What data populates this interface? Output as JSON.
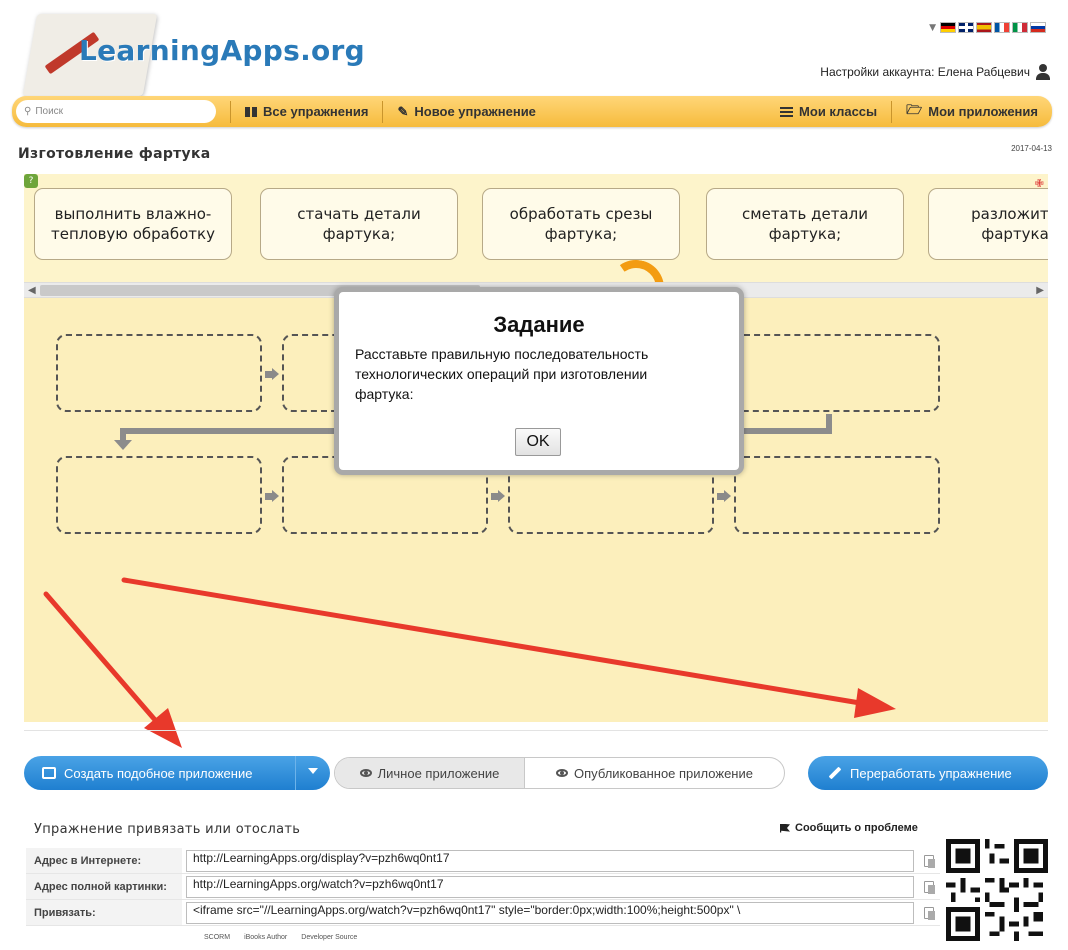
{
  "header": {
    "logo_text": "LearningApps.org",
    "account_label": "Настройки аккаунта: Елена Рабцевич",
    "languages": [
      {
        "name": "Deutsch",
        "colors": [
          "#000000",
          "#dd0000",
          "#ffce00"
        ]
      },
      {
        "name": "English",
        "colors": [
          "#012169",
          "#ffffff",
          "#c8102e"
        ]
      },
      {
        "name": "Español",
        "colors": [
          "#aa151b",
          "#f1bf00",
          "#aa151b"
        ]
      },
      {
        "name": "Français",
        "colors": [
          "#0055a4",
          "#ffffff",
          "#ef4135"
        ]
      },
      {
        "name": "Italiano",
        "colors": [
          "#009246",
          "#ffffff",
          "#ce2b37"
        ]
      },
      {
        "name": "Русский",
        "colors": [
          "#ffffff",
          "#0039a6",
          "#d52b1e"
        ]
      }
    ]
  },
  "nav": {
    "search_placeholder": "Поиск",
    "all_exercises": "Все упражнения",
    "new_exercise": "Новое упражнение",
    "my_classes": "Мои классы",
    "my_apps": "Мои приложения"
  },
  "page": {
    "title": "Изготовление фартука",
    "date": "2017-04-13"
  },
  "app": {
    "cards": [
      "выполнить влажно-\nтепловую обработку",
      "стачать детали\nфартука;",
      "обработать срезы\nфартука;",
      "сметать детали\nфартука;",
      "разложить вы\nфартука на"
    ]
  },
  "modal": {
    "title": "Задание",
    "text": "Расставьте правильную последовательность технологических операций при изготовлении фартука:",
    "ok_label": "OK"
  },
  "actions": {
    "create_similar": "Создать подобное приложение",
    "private_app": "Личное приложение",
    "published_app": "Опубликованное приложение",
    "rework": "Переработать упражнение"
  },
  "share": {
    "title": "Упражнение привязать или отослать",
    "report_problem": "Сообщить о проблеме",
    "rows": [
      {
        "label": "Адрес в Интернете:",
        "value": "http://LearningApps.org/display?v=pzh6wq0nt17"
      },
      {
        "label": "Адрес полной картинки:",
        "value": "http://LearningApps.org/watch?v=pzh6wq0nt17"
      },
      {
        "label": "Привязать:",
        "value": "<iframe src=\"//LearningApps.org/watch?v=pzh6wq0nt17\" style=\"border:0px;width:100%;height:500px\" \\"
      }
    ],
    "exports": [
      "SCORM",
      "iBooks Author",
      "Developer Source"
    ]
  },
  "colors": {
    "nav_bar": "#f6bb3c",
    "accent_blue": "#1f7fd0",
    "logo_blue": "#2a7ab8",
    "app_bg": "#fcefbc",
    "annotation_red": "#e8392b"
  }
}
